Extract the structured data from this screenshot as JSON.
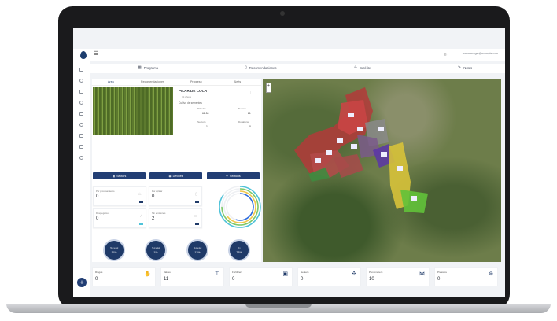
{
  "header": {
    "user_email": "farmmanager@example.com",
    "menu_icon": "hamburger-icon"
  },
  "tabs": [
    {
      "label": "Programa",
      "icon": "calendar-icon"
    },
    {
      "label": "Recomendaciones",
      "icon": "clipboard-icon"
    },
    {
      "label": "Satélite",
      "icon": "satellite-icon"
    },
    {
      "label": "Notas",
      "icon": "pin-icon"
    }
  ],
  "subtabs": [
    "Área",
    "Recomendaciones",
    "Progreso",
    "Alerts"
  ],
  "farm": {
    "title": "PILAR DE COCA",
    "subtitle": "32,2hecs",
    "details_heading": "Cultivo de sementes",
    "details": [
      {
        "label": "Tabelas",
        "value": "68.54"
      },
      {
        "label": "Nomes",
        "value": "21"
      },
      {
        "label": "Sectors",
        "value": "11"
      },
      {
        "label": "Dotations",
        "value": "0"
      }
    ]
  },
  "actions": {
    "sectors_label": "Sectors",
    "devices_label": "Devices",
    "sections_label": "Sections"
  },
  "cards": [
    {
      "label": "Por procesamiento",
      "value": "0",
      "icon": "drop-icon"
    },
    {
      "label": "Por aplicar",
      "value": "0",
      "icon": "document-icon"
    },
    {
      "label": "Desplegamos",
      "value": "0",
      "icon": "leaf-icon"
    },
    {
      "label": "Sin emisiones",
      "value": "2",
      "icon": "battery-icon"
    }
  ],
  "ring_chart": {
    "series_colors": [
      "#4fc3d9",
      "#7ec96a",
      "#f2c94c",
      "#2d6cdf"
    ],
    "values": [
      0.85,
      0.75,
      0.65,
      0.55
    ]
  },
  "gauges": [
    {
      "label": "Humedad",
      "value": "11%"
    },
    {
      "label": "Humedad",
      "value": "1%"
    },
    {
      "label": "Humedad",
      "value": "12%"
    },
    {
      "label": "Rn",
      "value": "73%"
    }
  ],
  "bottom": [
    {
      "label": "Riegos",
      "value": "0",
      "icon": "hand-drop-icon"
    },
    {
      "label": "Valves",
      "value": "11",
      "icon": "faucet-icon"
    },
    {
      "label": "Fertilizers",
      "value": "0",
      "icon": "fertilizer-icon"
    },
    {
      "label": "Heaters",
      "value": "0",
      "icon": "fan-icon"
    },
    {
      "label": "Pluviometers",
      "value": "10",
      "icon": "flow-icon"
    },
    {
      "label": "Pressure",
      "value": "0",
      "icon": "gauge-icon"
    }
  ],
  "fab_label": "+"
}
